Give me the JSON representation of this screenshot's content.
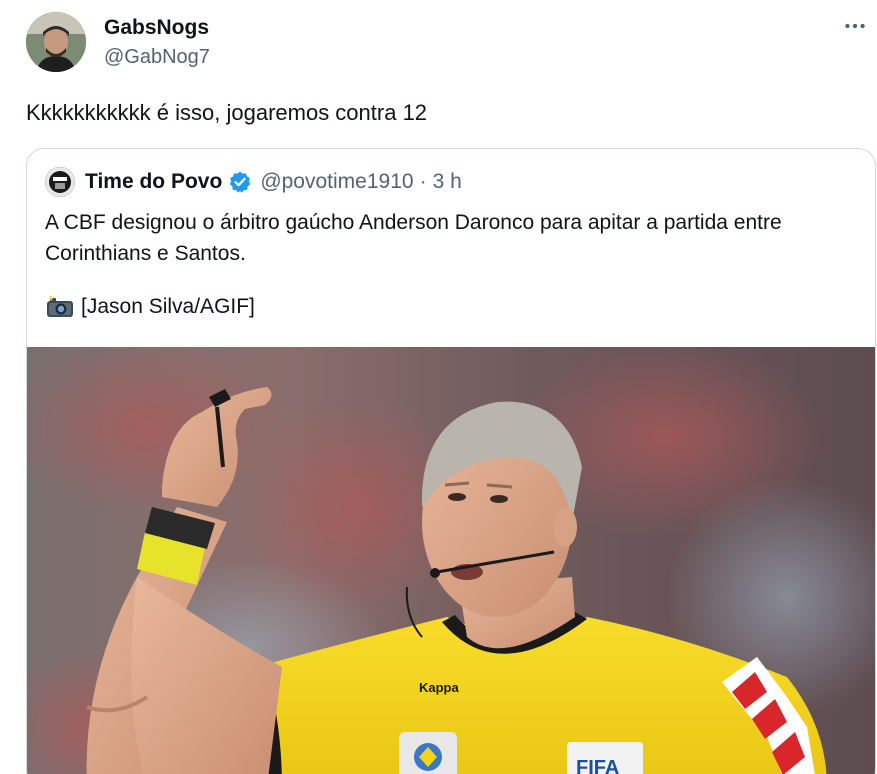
{
  "author": {
    "display_name": "GabsNogs",
    "handle": "@GabNog7",
    "avatar_icon": "user-avatar"
  },
  "tweet": {
    "text": "Kkkkkkkkkkk é isso, jogaremos contra 12"
  },
  "menu": {
    "icon": "more-dots-icon"
  },
  "quoted": {
    "display_name": "Time do Povo",
    "verified": true,
    "verified_color": "#1d9bf0",
    "handle": "@povotime1910",
    "separator": "·",
    "time": "3 h",
    "text_line1": "A CBF designou o árbitro gaúcho Anderson Daronco para apitar a partida entre",
    "text_line2": "Corinthians e Santos.",
    "credit_icon": "camera-flash-icon",
    "credit_text": "[Jason Silva/AGIF]",
    "image": {
      "description_icon": "referee-photo",
      "kit_brand": "Kappa",
      "badge": "FIFA",
      "shirt_color": "#f4d41b"
    }
  }
}
